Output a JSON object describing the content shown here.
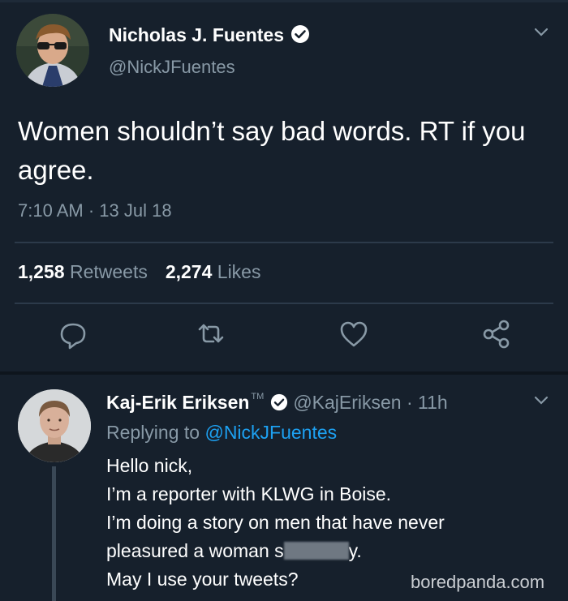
{
  "main_tweet": {
    "author_name": "Nicholas J. Fuentes",
    "author_handle": "@NickJFuentes",
    "text": "Women shouldn’t say bad words. RT if you agree.",
    "timestamp": "7:10 AM · 13 Jul 18",
    "retweets_count": "1,258",
    "retweets_label": "Retweets",
    "likes_count": "2,274",
    "likes_label": "Likes",
    "actions": [
      "reply-icon",
      "retweet-icon",
      "like-icon",
      "share-icon"
    ]
  },
  "reply": {
    "author_name": "Kaj-Erik Eriksen",
    "author_badge": "TM",
    "author_handle": "@KajEriksen · 11h",
    "replying_prefix": "Replying to",
    "replying_handle": "@NickJFuentes",
    "lines": [
      "Hello nick,",
      "I’m a reporter with KLWG in Boise.",
      "I’m doing a story on men that have never"
    ],
    "line4_before": "pleasured a woman s",
    "line4_after": "y.",
    "line5": "May I use your tweets?"
  },
  "watermark": "boredpanda.com",
  "colors": {
    "background": "#16202c",
    "secondary_text": "#8899a6",
    "link": "#1da1f2"
  }
}
